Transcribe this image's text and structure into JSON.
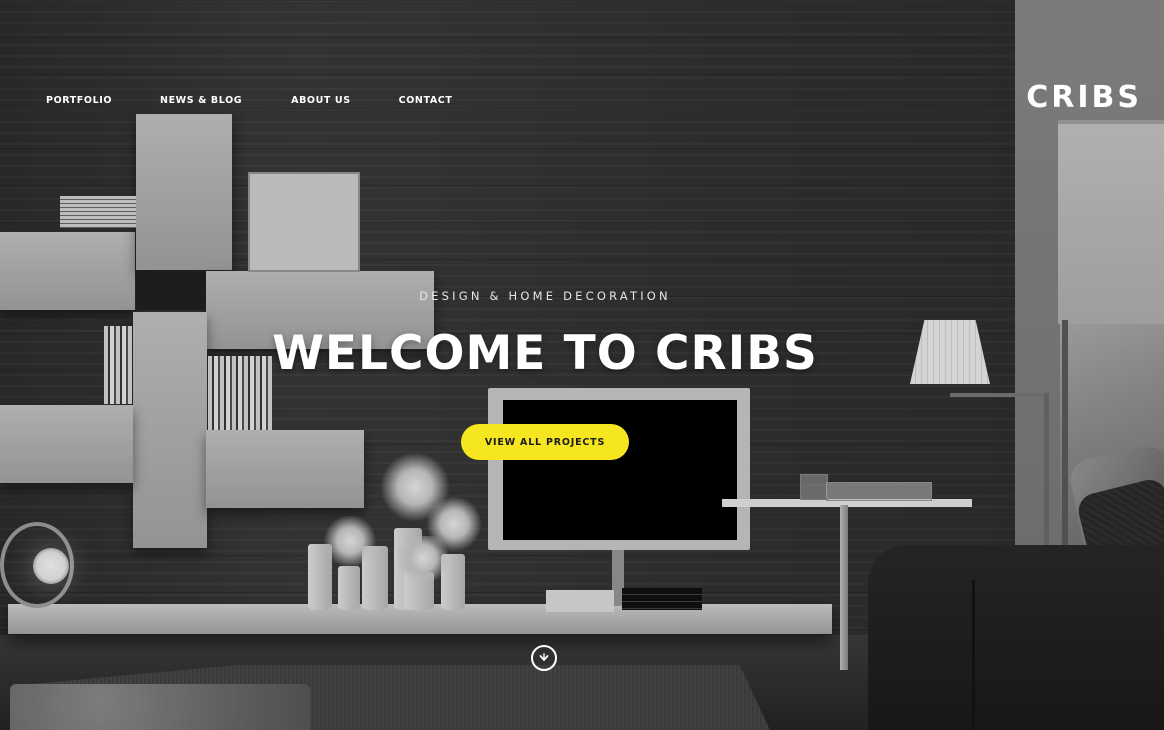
{
  "nav": {
    "items": [
      {
        "label": "PORTFOLIO"
      },
      {
        "label": "NEWS & BLOG"
      },
      {
        "label": "ABOUT US"
      },
      {
        "label": "CONTACT"
      }
    ]
  },
  "brand": {
    "logo_text": "CRIBS"
  },
  "hero": {
    "tagline": "DESIGN & HOME DECORATION",
    "headline": "WELCOME TO CRIBS",
    "cta_label": "VIEW ALL PROJECTS",
    "scroll_icon": "chevron-down-circle-icon"
  },
  "colors": {
    "accent": "#f5e61f",
    "text": "#ffffff"
  }
}
